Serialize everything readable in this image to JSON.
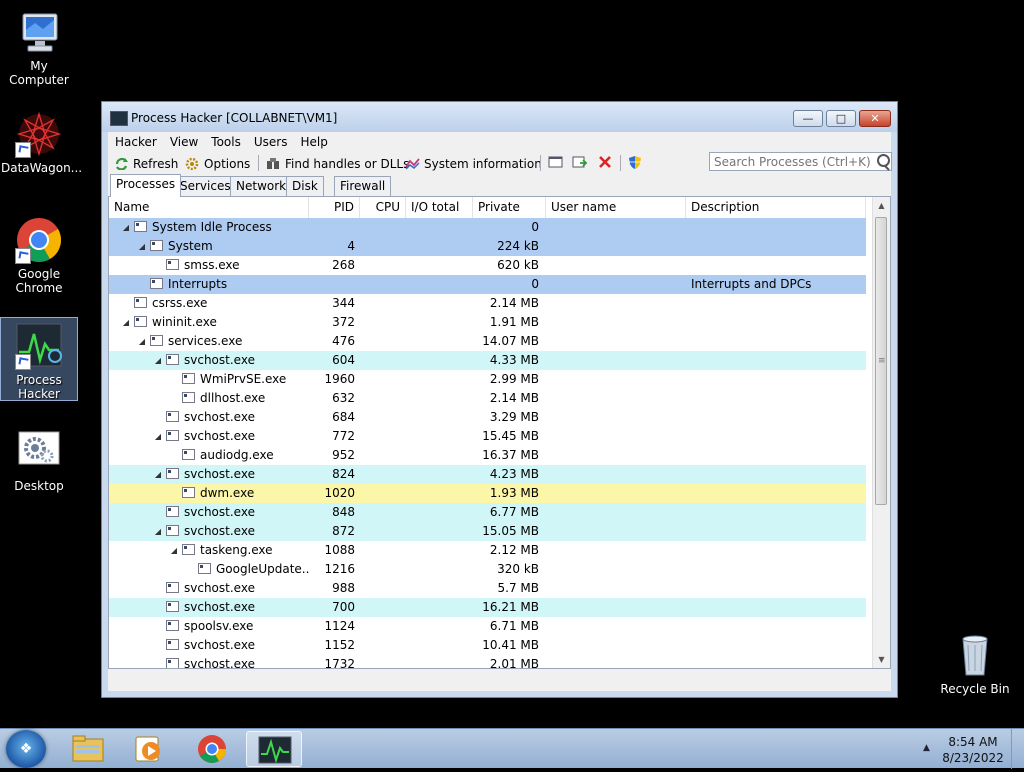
{
  "desktop": {
    "icons": [
      {
        "label": "My Computer"
      },
      {
        "label": "DataWagon..."
      },
      {
        "label": "Google Chrome"
      },
      {
        "label": "Process Hacker"
      },
      {
        "label": "Desktop"
      },
      {
        "label": "Recycle Bin"
      }
    ]
  },
  "window": {
    "title": "Process Hacker [COLLABNET\\VM1]",
    "controls": {
      "minimize": "—",
      "maximize": "□",
      "close": "✕"
    },
    "menu": [
      "Hacker",
      "View",
      "Tools",
      "Users",
      "Help"
    ],
    "toolbar": {
      "refresh": "Refresh",
      "options": "Options",
      "find": "Find handles or DLLs",
      "sysinfo": "System information"
    },
    "search": {
      "placeholder": "Search Processes (Ctrl+K)"
    },
    "tabs": [
      "Processes",
      "Services",
      "Network",
      "Disk",
      "Firewall"
    ],
    "active_tab": "Processes",
    "columns": {
      "name": "Name",
      "pid": "PID",
      "cpu": "CPU",
      "io": "I/O total ...",
      "private": "Private b...",
      "user": "User name",
      "desc": "Description"
    },
    "processes": [
      {
        "name": "System Idle Process",
        "pid": "",
        "private": "0",
        "desc": "",
        "depth": 0,
        "expand": true,
        "hl": "blue"
      },
      {
        "name": "System",
        "pid": "4",
        "private": "224 kB",
        "desc": "",
        "depth": 1,
        "expand": true,
        "hl": "blue"
      },
      {
        "name": "smss.exe",
        "pid": "268",
        "private": "620 kB",
        "desc": "",
        "depth": 2,
        "expand": false,
        "hl": ""
      },
      {
        "name": "Interrupts",
        "pid": "",
        "private": "0",
        "desc": "Interrupts and DPCs",
        "depth": 1,
        "expand": false,
        "hl": "blue"
      },
      {
        "name": "csrss.exe",
        "pid": "344",
        "private": "2.14 MB",
        "desc": "",
        "depth": 0,
        "expand": false,
        "hl": ""
      },
      {
        "name": "wininit.exe",
        "pid": "372",
        "private": "1.91 MB",
        "desc": "",
        "depth": 0,
        "expand": true,
        "hl": ""
      },
      {
        "name": "services.exe",
        "pid": "476",
        "private": "14.07 MB",
        "desc": "",
        "depth": 1,
        "expand": true,
        "hl": ""
      },
      {
        "name": "svchost.exe",
        "pid": "604",
        "private": "4.33 MB",
        "desc": "",
        "depth": 2,
        "expand": true,
        "hl": "cyan"
      },
      {
        "name": "WmiPrvSE.exe",
        "pid": "1960",
        "private": "2.99 MB",
        "desc": "",
        "depth": 3,
        "expand": false,
        "hl": ""
      },
      {
        "name": "dllhost.exe",
        "pid": "632",
        "private": "2.14 MB",
        "desc": "",
        "depth": 3,
        "expand": false,
        "hl": ""
      },
      {
        "name": "svchost.exe",
        "pid": "684",
        "private": "3.29 MB",
        "desc": "",
        "depth": 2,
        "expand": false,
        "hl": ""
      },
      {
        "name": "svchost.exe",
        "pid": "772",
        "private": "15.45 MB",
        "desc": "",
        "depth": 2,
        "expand": true,
        "hl": ""
      },
      {
        "name": "audiodg.exe",
        "pid": "952",
        "private": "16.37 MB",
        "desc": "",
        "depth": 3,
        "expand": false,
        "hl": ""
      },
      {
        "name": "svchost.exe",
        "pid": "824",
        "private": "4.23 MB",
        "desc": "",
        "depth": 2,
        "expand": true,
        "hl": "cyan"
      },
      {
        "name": "dwm.exe",
        "pid": "1020",
        "private": "1.93 MB",
        "desc": "",
        "depth": 3,
        "expand": false,
        "hl": "yellow"
      },
      {
        "name": "svchost.exe",
        "pid": "848",
        "private": "6.77 MB",
        "desc": "",
        "depth": 2,
        "expand": false,
        "hl": "cyan"
      },
      {
        "name": "svchost.exe",
        "pid": "872",
        "private": "15.05 MB",
        "desc": "",
        "depth": 2,
        "expand": true,
        "hl": "cyan"
      },
      {
        "name": "taskeng.exe",
        "pid": "1088",
        "private": "2.12 MB",
        "desc": "",
        "depth": 3,
        "expand": true,
        "hl": ""
      },
      {
        "name": "GoogleUpdate....",
        "pid": "1216",
        "private": "320 kB",
        "desc": "",
        "depth": 4,
        "expand": false,
        "hl": ""
      },
      {
        "name": "svchost.exe",
        "pid": "988",
        "private": "5.7 MB",
        "desc": "",
        "depth": 2,
        "expand": false,
        "hl": ""
      },
      {
        "name": "svchost.exe",
        "pid": "700",
        "private": "16.21 MB",
        "desc": "",
        "depth": 2,
        "expand": false,
        "hl": "cyan"
      },
      {
        "name": "spoolsv.exe",
        "pid": "1124",
        "private": "6.71 MB",
        "desc": "",
        "depth": 2,
        "expand": false,
        "hl": ""
      },
      {
        "name": "svchost.exe",
        "pid": "1152",
        "private": "10.41 MB",
        "desc": "",
        "depth": 2,
        "expand": false,
        "hl": ""
      },
      {
        "name": "svchost.exe",
        "pid": "1732",
        "private": "2.01 MB",
        "desc": "",
        "depth": 2,
        "expand": false,
        "hl": ""
      }
    ]
  },
  "taskbar": {
    "time": "8:54 AM",
    "date": "8/23/2022"
  },
  "colors": {
    "highlight_system": "#aecbf2",
    "highlight_service": "#d0f6f8",
    "highlight_gui": "#fcf6a8",
    "titlebar": "#c9d9ee"
  },
  "icons": [
    "computer-icon",
    "datawagon-icon",
    "chrome-icon",
    "processhacker-icon",
    "desktop-settings-icon",
    "recycle-bin-icon",
    "refresh-icon",
    "options-icon",
    "find-icon",
    "sysinfo-icon",
    "search-icon"
  ]
}
